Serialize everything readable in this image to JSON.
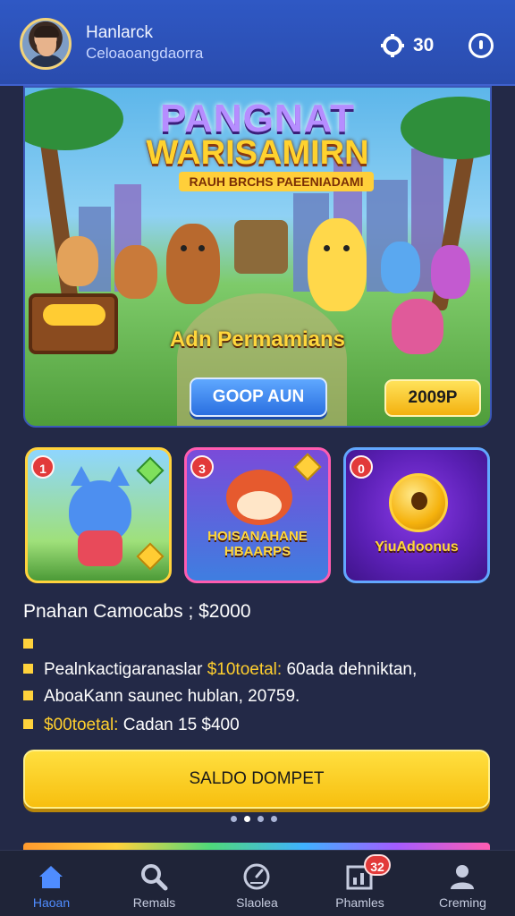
{
  "header": {
    "user_name": "Hanlarck",
    "user_subtitle": "Celoaoangdaorra",
    "coins": "30"
  },
  "banner": {
    "title_line1": "PANGNAT",
    "title_line2": "WARISAMIRN",
    "ribbon": "RAUH BRCHS PAEENIADAMI",
    "subtitle": "Adn Permamians",
    "play_label": "GOOP AUN",
    "price_label": "2009P"
  },
  "cards": [
    {
      "badge": "1",
      "label": ""
    },
    {
      "badge": "3",
      "label": "HOISANAHANE HBAARPS"
    },
    {
      "badge": "0",
      "label": "YiuAdoonus"
    }
  ],
  "info": {
    "title": "Pnahan Camocabs ; $2000",
    "rows": [
      {
        "text": ""
      },
      {
        "text_a": "Pealnkactigaranaslar ",
        "highlight": "$10toetal:",
        "text_b": " 60ada dehniktan,"
      },
      {
        "text_a": "AboaKann saunec hublan, 20759.",
        "highlight": "",
        "text_b": ""
      },
      {
        "text_a": "",
        "highlight": "$00toetal:",
        "text_b": " Cadan 15 $400"
      }
    ]
  },
  "saldo_button": "SALDO DOMPET",
  "nav": {
    "items": [
      {
        "label": "Haoan",
        "icon": "home-icon"
      },
      {
        "label": "Remals",
        "icon": "search-icon"
      },
      {
        "label": "Slaolea",
        "icon": "clock-icon"
      },
      {
        "label": "Phamles",
        "icon": "chart-icon",
        "badge": "32"
      },
      {
        "label": "Creming",
        "icon": "profile-icon"
      }
    ]
  },
  "colors": {
    "accent": "#ffd23c",
    "header_blue": "#2f58c4",
    "background": "#232947",
    "active_nav": "#4f8cff"
  }
}
